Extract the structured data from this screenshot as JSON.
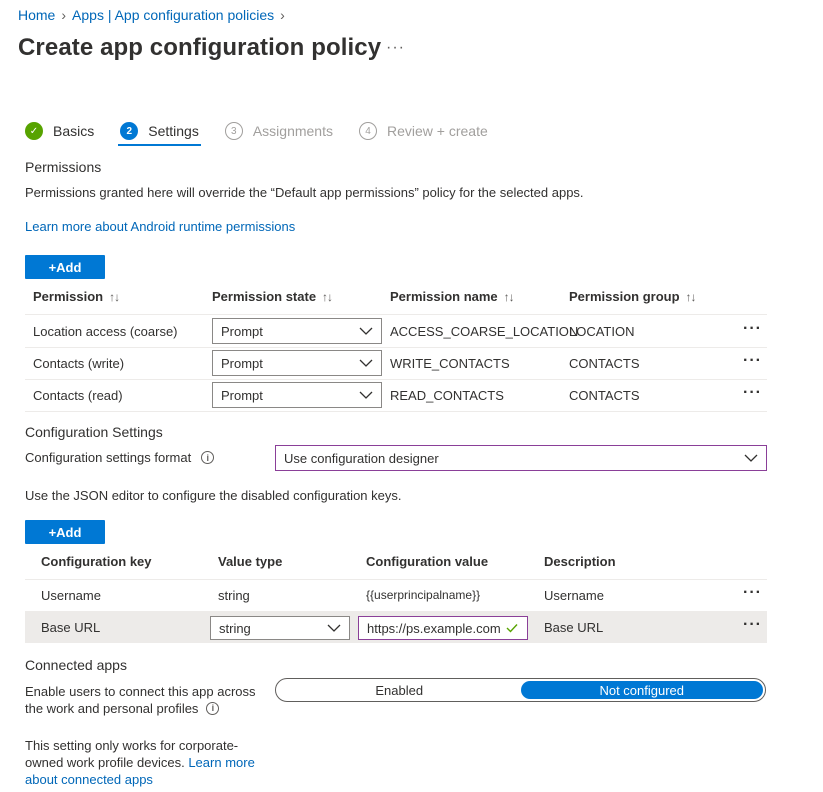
{
  "breadcrumb": {
    "home": "Home",
    "apps": "Apps | App configuration policies"
  },
  "page": {
    "title": "Create app configuration policy",
    "more": "···"
  },
  "steps": [
    {
      "num": "✓",
      "label": "Basics",
      "state": "done"
    },
    {
      "num": "2",
      "label": "Settings",
      "state": "active"
    },
    {
      "num": "3",
      "label": "Assignments",
      "state": "pending"
    },
    {
      "num": "4",
      "label": "Review + create",
      "state": "pending"
    }
  ],
  "permissions": {
    "title": "Permissions",
    "description": "Permissions granted here will override the “Default app permissions” policy for the selected apps.",
    "learn_more": "Learn more about Android runtime permissions",
    "add_label": "+Add",
    "columns": {
      "permission": "Permission",
      "state": "Permission state",
      "name": "Permission name",
      "group": "Permission group"
    },
    "sort_glyph": "↑↓",
    "rows": [
      {
        "permission": "Location access (coarse)",
        "state": "Prompt",
        "name": "ACCESS_COARSE_LOCATION",
        "group": "LOCATION"
      },
      {
        "permission": "Contacts (write)",
        "state": "Prompt",
        "name": "WRITE_CONTACTS",
        "group": "CONTACTS"
      },
      {
        "permission": "Contacts (read)",
        "state": "Prompt",
        "name": "READ_CONTACTS",
        "group": "CONTACTS"
      }
    ]
  },
  "config": {
    "title": "Configuration Settings",
    "format_label": "Configuration settings format",
    "format_value": "Use configuration designer",
    "json_note": "Use the JSON editor to configure the disabled configuration keys.",
    "add_label": "+Add",
    "columns": {
      "key": "Configuration key",
      "type": "Value type",
      "value": "Configuration value",
      "desc": "Description"
    },
    "rows": [
      {
        "key": "Username",
        "type": "string",
        "value": "{{userprincipalname}}",
        "desc": "Username"
      },
      {
        "key": "Base URL",
        "type": "string",
        "value": "https://ps.example.com",
        "desc": "Base URL"
      }
    ]
  },
  "connected": {
    "title": "Connected apps",
    "label_line1": "Enable users to connect this app across",
    "label_line2": "the work and personal profiles",
    "enabled": "Enabled",
    "not_configured": "Not configured",
    "note_line1": "This setting only works for corporate-",
    "note_line2": "owned work profile devices.",
    "note_link1": "Learn more",
    "note_link2": "about connected apps"
  },
  "colors": {
    "accent": "#0078d4",
    "success": "#57a300",
    "focus": "#8a3f98"
  }
}
